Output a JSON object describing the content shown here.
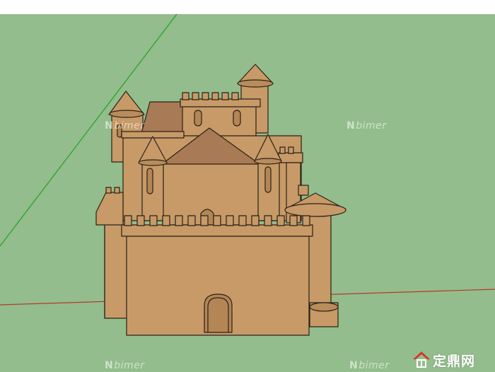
{
  "viewport": {
    "sky_color": "#ffffff",
    "ground_color": "#93bd8c",
    "model_color": "#c79a67",
    "edge_color": "#2b2118",
    "roof_color": "#a87a55"
  },
  "axes": {
    "green_axis": "#1fa31f",
    "red_axis": "#b53a2e"
  },
  "watermarks": [
    {
      "icon": "n-glyph",
      "text": "bimer"
    },
    {
      "icon": "n-glyph",
      "text": "bimer"
    },
    {
      "icon": "n-glyph",
      "text": "bimer"
    },
    {
      "icon": "n-glyph",
      "text": "bimer"
    }
  ],
  "brand_logo": {
    "icon": "roof-logo-icon",
    "text": "定鼎网"
  }
}
